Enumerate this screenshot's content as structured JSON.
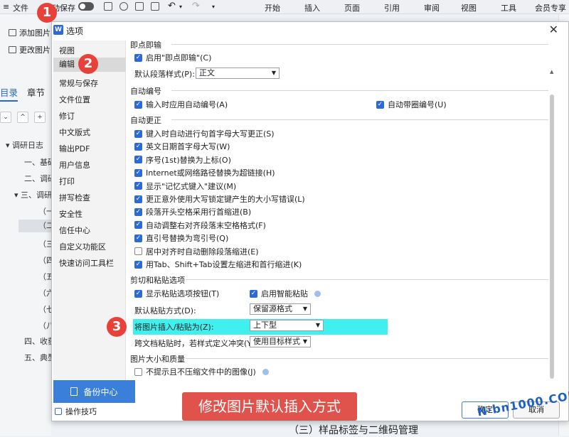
{
  "topbar": {
    "file": "文件",
    "autosave": "自动保存",
    "tabs": [
      "开始",
      "插入",
      "页面",
      "引用",
      "审阅",
      "视图",
      "工具",
      "会员专享"
    ]
  },
  "leftpane": {
    "add_image": "添加图片",
    "change_image": "更改图片",
    "tab_toc": "目录",
    "tab_chapter": "章节",
    "nav_up": "^",
    "nav_add": "+",
    "tree": [
      "调研日志",
      "一、基础",
      "二、调研",
      "三、调研",
      "（一",
      "（二",
      "（三",
      "（四",
      "（五",
      "（六",
      "（七",
      "（八",
      "四、收获",
      "五、典型"
    ]
  },
  "dialog": {
    "title": "选项",
    "nav": [
      "视图",
      "编辑",
      "常规与保存",
      "文件位置",
      "修订",
      "中文版式",
      "输出PDF",
      "用户信息",
      "打印",
      "拼写检查",
      "安全性",
      "信任中心",
      "自定义功能区",
      "快速访问工具栏"
    ],
    "nav_active": "编辑",
    "backup": "备份中心",
    "tips": "操作技巧",
    "sections": {
      "instant": {
        "title": "即点即输",
        "enable": "启用\"即点即输\"(C)",
        "default_style_label": "默认段落样式(P):",
        "default_style_value": "正文"
      },
      "autonum": {
        "title": "自动编号",
        "input_autonum": "输入时应用自动编号(A)",
        "circle_num": "自动带圈编号(U)"
      },
      "autocorrect": {
        "title": "自动更正",
        "items": [
          {
            "label": "键入时自动进行句首字母大写更正(S)",
            "checked": true
          },
          {
            "label": "英文日期首字母大写(W)",
            "checked": true
          },
          {
            "label": "序号(1st)替换为上标(O)",
            "checked": true
          },
          {
            "label": "Internet或网络路径替换为超链接(H)",
            "checked": true
          },
          {
            "label": "显示\"记忆式键入\"建议(M)",
            "checked": true
          },
          {
            "label": "更正意外使用大写锁定键产生的大小写错误(L)",
            "checked": true
          },
          {
            "label": "段落开头空格采用行首缩进(B)",
            "checked": true
          },
          {
            "label": "自动调整右对齐段落末空格格式(F)",
            "checked": true
          },
          {
            "label": "直引号替换为弯引号(Q)",
            "checked": true
          },
          {
            "label": "居中对齐时自动删除段落缩进(E)",
            "checked": false
          },
          {
            "label": "用Tab、Shift+Tab设置左缩进和首行缩进(K)",
            "checked": true
          }
        ]
      },
      "paste": {
        "title": "剪切和粘贴选项",
        "show_btn": "显示粘贴选项按钮(T)",
        "smart_paste": "启用智能粘贴",
        "default_paste_label": "默认粘贴方式(D):",
        "default_paste_value": "保留源格式",
        "insert_image_label": "将图片插入/粘贴为(Z):",
        "insert_image_value": "上下型",
        "cross_doc_label": "跨文档粘贴时，若样式定义冲突(Y):",
        "cross_doc_value": "使用目标样式"
      },
      "image": {
        "title": "图片大小和质量",
        "no_compress": "不提示且不压缩文件中的图像(J)"
      }
    },
    "ok": "确定",
    "cancel": "取消"
  },
  "caption": "修改图片默认插入方式",
  "markers": [
    "1",
    "2",
    "3"
  ],
  "watermark": "N·bn1000.COM",
  "bottom_text": "（三）样品标签与二维码管理",
  "colors": {
    "accent": "#2b6ad8",
    "highlight": "#3ff0ee",
    "marker": "#e8413a",
    "caption": "#e0534c"
  }
}
